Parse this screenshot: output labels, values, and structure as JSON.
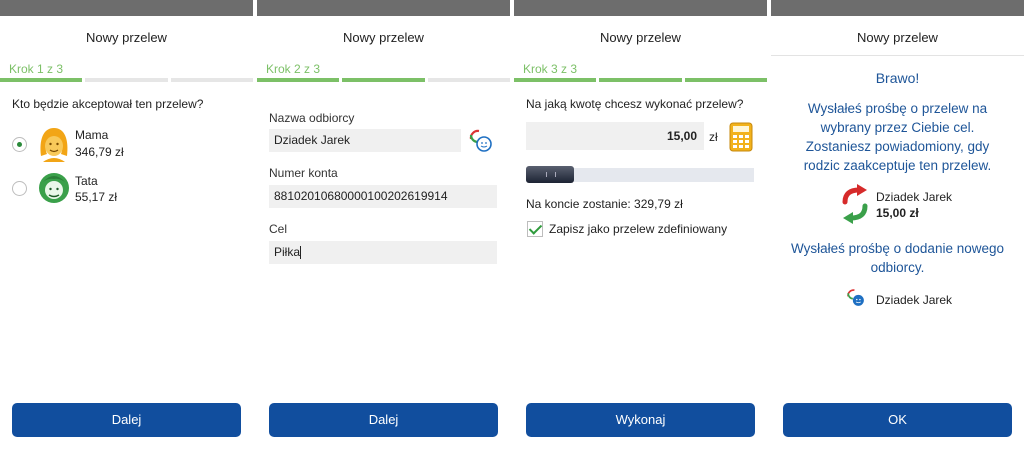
{
  "screen1": {
    "title": "Nowy przelew",
    "step": "Krok 1 z 3",
    "question": "Kto będzie akceptował ten przelew?",
    "people": [
      {
        "name": "Mama",
        "amount": "346,79 zł",
        "selected": true
      },
      {
        "name": "Tata",
        "amount": "55,17 zł",
        "selected": false
      }
    ],
    "button": "Dalej"
  },
  "screen2": {
    "title": "Nowy przelew",
    "step": "Krok 2 z 3",
    "recipient_label": "Nazwa odbiorcy",
    "recipient_value": "Dziadek Jarek",
    "account_label": "Numer konta",
    "account_value": "88102010680000100202619914",
    "purpose_label": "Cel",
    "purpose_value": "Piłka",
    "button": "Dalej"
  },
  "screen3": {
    "title": "Nowy przelew",
    "step": "Krok 3 z 3",
    "question": "Na jaką kwotę chcesz wykonać przelew?",
    "amount": "15,00",
    "currency": "zł",
    "balance": "Na koncie zostanie: 329,79 zł",
    "save_label": "Zapisz jako przelew zdefiniowany",
    "button": "Wykonaj"
  },
  "screen4": {
    "title": "Nowy przelew",
    "heading": "Brawo!",
    "message": [
      "Wysłałeś prośbę o przelew na",
      "wybrany przez Ciebie cel.",
      "Zostaniesz powiadomiony, gdy",
      "rodzic zaakceptuje ten przelew."
    ],
    "recipient": "Dziadek Jarek",
    "amount": "15,00 zł",
    "message2": [
      "Wysłałeś prośbę o dodanie nowego",
      "odbiorcy."
    ],
    "recipient2": "Dziadek Jarek",
    "button": "OK"
  },
  "colors": {
    "accent": "#7cc067",
    "button": "#114e9e",
    "text_blue": "#1e5598"
  }
}
